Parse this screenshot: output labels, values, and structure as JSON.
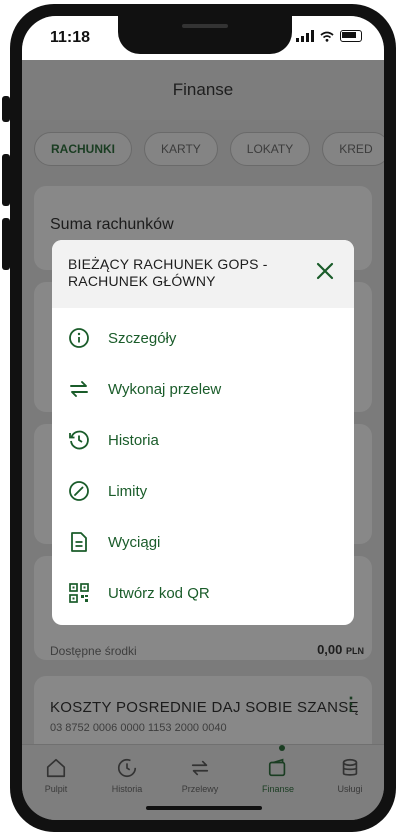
{
  "status_bar": {
    "time": "11:18"
  },
  "header": {
    "title": "Finanse"
  },
  "tabs": [
    {
      "label": "RACHUNKI",
      "active": true
    },
    {
      "label": "KARTY"
    },
    {
      "label": "LOKATY"
    },
    {
      "label": "KRED"
    }
  ],
  "background": {
    "suma_label": "Suma rachunków",
    "available_label": "Dostępne środki",
    "available_value": "0,00",
    "available_currency": "PLN",
    "account2_name": "KOSZTY POSREDNIE DAJ SOBIE SZANSĘ",
    "account2_number": "03 8752 0006 0000 1153 2000 0040"
  },
  "modal": {
    "title": "BIEŻĄCY RACHUNEK GOPS - RACHUNEK GŁÓWNY",
    "items": [
      {
        "label": "Szczegóły",
        "icon": "info-icon"
      },
      {
        "label": "Wykonaj przelew",
        "icon": "transfer-icon"
      },
      {
        "label": "Historia",
        "icon": "history-icon"
      },
      {
        "label": "Limity",
        "icon": "gauge-icon"
      },
      {
        "label": "Wyciągi",
        "icon": "document-icon"
      },
      {
        "label": "Utwórz kod QR",
        "icon": "qr-code-icon"
      }
    ]
  },
  "bottom_nav": [
    {
      "label": "Pulpit",
      "icon": "home-icon"
    },
    {
      "label": "Historia",
      "icon": "history-icon"
    },
    {
      "label": "Przelewy",
      "icon": "transfer-icon"
    },
    {
      "label": "Finanse",
      "icon": "wallet-icon",
      "active": true
    },
    {
      "label": "Usługi",
      "icon": "database-icon"
    }
  ],
  "colors": {
    "accent": "#1a5c2a",
    "overlay": "#7b7b7b",
    "modal_header": "#f2f2f2"
  }
}
